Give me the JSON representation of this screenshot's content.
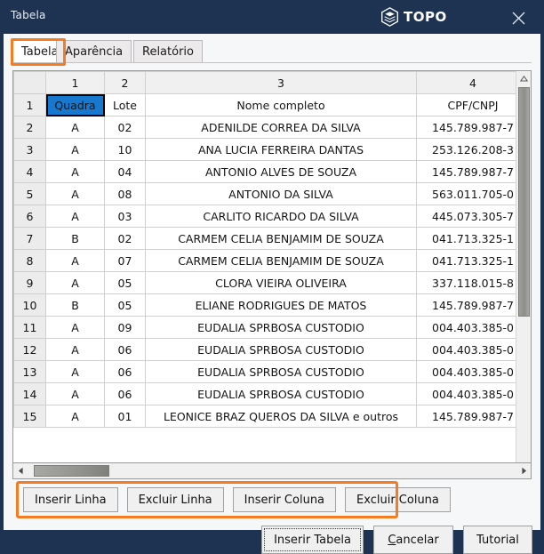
{
  "window": {
    "title": "Tabela",
    "brand": "TOPO",
    "close_icon": "close-icon",
    "logo_icon": "topo-logo-icon"
  },
  "tabs": [
    {
      "label": "Tabela",
      "active": true
    },
    {
      "label": "Aparência",
      "active": false
    },
    {
      "label": "Relatório",
      "active": false
    }
  ],
  "grid": {
    "column_headers": [
      "1",
      "2",
      "3",
      "4"
    ],
    "row_headers": [
      "1",
      "2",
      "3",
      "4",
      "5",
      "6",
      "7",
      "8",
      "9",
      "10",
      "11",
      "12",
      "13",
      "14",
      "15"
    ],
    "selected_cell": {
      "row": 1,
      "col": 1,
      "value": "Quadra"
    },
    "rows": [
      [
        "Quadra",
        "Lote",
        "Nome completo",
        "CPF/CNPJ"
      ],
      [
        "A",
        "02",
        "ADENILDE CORREA DA SILVA",
        "145.789.987-7"
      ],
      [
        "A",
        "10",
        "ANA LUCIA FERREIRA DANTAS",
        "253.126.208-3"
      ],
      [
        "A",
        "04",
        "ANTONIO ALVES DE SOUZA",
        "145.789.987-7"
      ],
      [
        "A",
        "08",
        "ANTONIO DA SILVA",
        "563.011.705-0"
      ],
      [
        "A",
        "03",
        "CARLITO RICARDO DA SILVA",
        "445.073.305-7"
      ],
      [
        "B",
        "02",
        "CARMEM CELIA BENJAMIM DE SOUZA",
        "041.713.325-1"
      ],
      [
        "A",
        "07",
        "CARMEM CELIA BENJAMIM DE SOUZA",
        "041.713.325-1"
      ],
      [
        "A",
        "05",
        "CLORA VIEIRA OLIVEIRA",
        "337.118.015-8"
      ],
      [
        "B",
        "05",
        "ELIANE RODRIGUES DE MATOS",
        "145.789.987-7"
      ],
      [
        "A",
        "09",
        "EUDALIA SPRBOSA CUSTODIO",
        "004.403.385-0"
      ],
      [
        "A",
        "06",
        "EUDALIA SPRBOSA CUSTODIO",
        "004.403.385-0"
      ],
      [
        "A",
        "06",
        "EUDALIA SPRBOSA CUSTODIO",
        "004.403.385-0"
      ],
      [
        "A",
        "06",
        "EUDALIA SPRBOSA CUSTODIO",
        "004.403.385-0"
      ],
      [
        "A",
        "01",
        "LEONICE BRAZ QUEROS DA SILVA e outros",
        "145.789.987-7"
      ]
    ]
  },
  "row_col_buttons": [
    {
      "label": "Inserir Linha"
    },
    {
      "label": "Excluir Linha"
    },
    {
      "label": "Inserir Coluna"
    },
    {
      "label": "Excluir Coluna"
    }
  ],
  "footer_buttons": {
    "insert_table": "Inserir Tabela",
    "cancel_prefix": "C",
    "cancel_rest": "ancelar",
    "tutorial": "Tutorial"
  },
  "colors": {
    "titlebar": "#1e3252",
    "highlight_orange": "#f57c20",
    "selection_blue": "#1778d0",
    "header_blue": "#1816e0"
  }
}
